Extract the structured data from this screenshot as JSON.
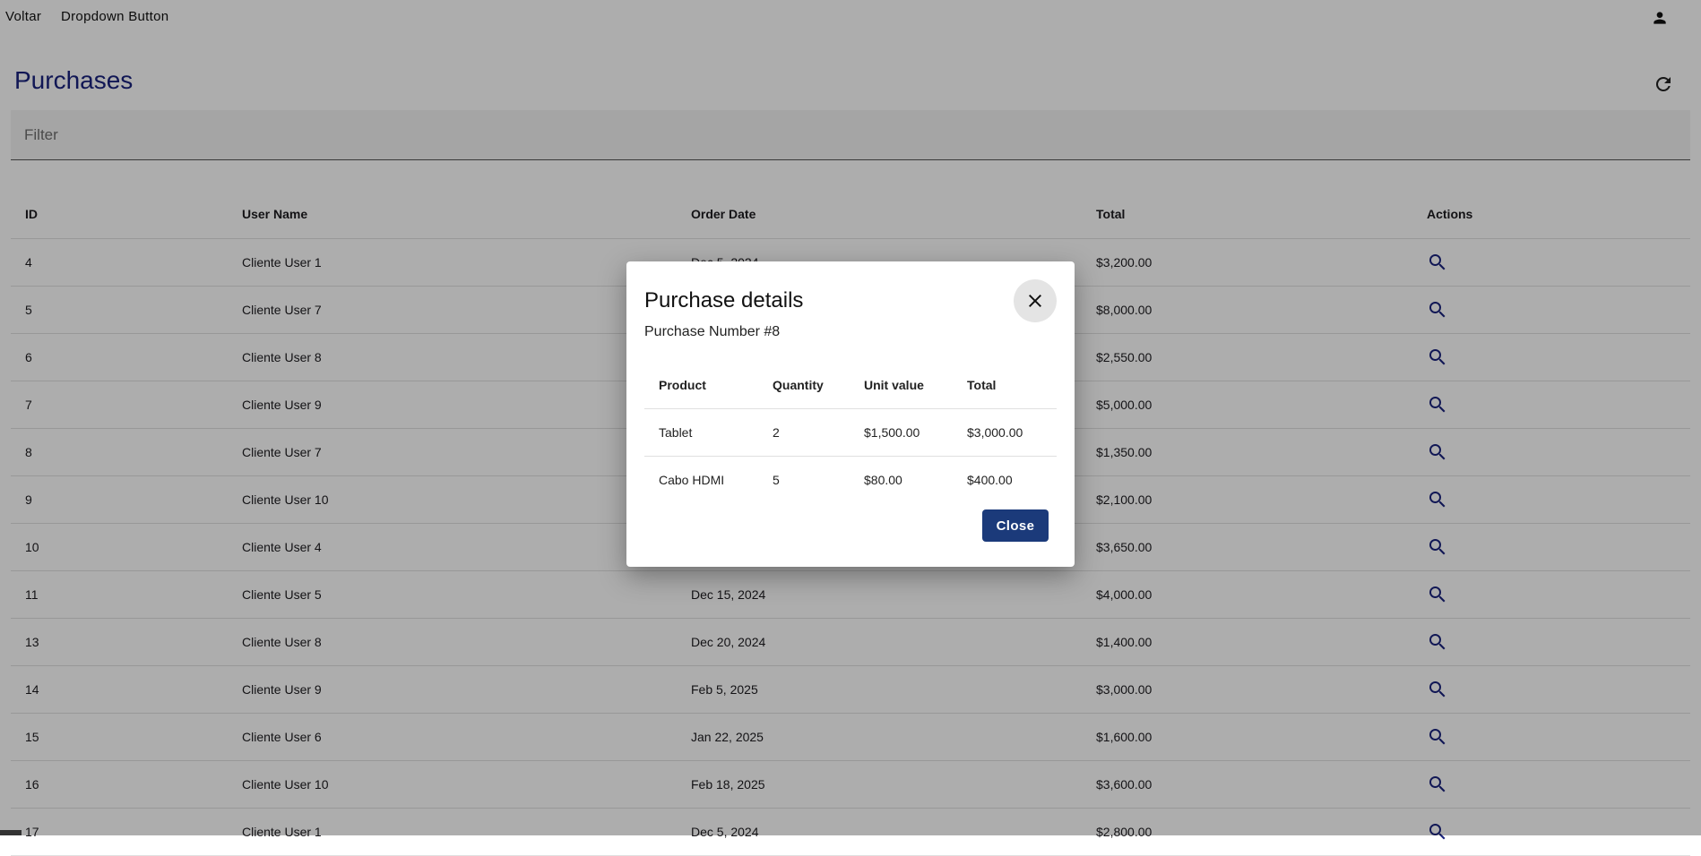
{
  "topbar": {
    "brand": "Voltar",
    "dropdown": "Dropdown Button",
    "user_icon": "account-icon"
  },
  "page": {
    "title": "Purchases",
    "refresh_icon": "refresh-icon"
  },
  "filter": {
    "placeholder": "Filter",
    "value": ""
  },
  "table": {
    "headers": {
      "id": "ID",
      "user": "User Name",
      "date": "Order Date",
      "total": "Total",
      "actions": "Actions"
    },
    "rows": [
      {
        "id": "4",
        "user": "Cliente User 1",
        "date": "Dec 5, 2024",
        "total": "$3,200.00"
      },
      {
        "id": "5",
        "user": "Cliente User 7",
        "date": "",
        "total": "$8,000.00"
      },
      {
        "id": "6",
        "user": "Cliente User 8",
        "date": "",
        "total": "$2,550.00"
      },
      {
        "id": "7",
        "user": "Cliente User 9",
        "date": "",
        "total": "$5,000.00"
      },
      {
        "id": "8",
        "user": "Cliente User 7",
        "date": "",
        "total": "$1,350.00"
      },
      {
        "id": "9",
        "user": "Cliente User 10",
        "date": "",
        "total": "$2,100.00"
      },
      {
        "id": "10",
        "user": "Cliente User 4",
        "date": "",
        "total": "$3,650.00"
      },
      {
        "id": "11",
        "user": "Cliente User 5",
        "date": "Dec 15, 2024",
        "total": "$4,000.00"
      },
      {
        "id": "13",
        "user": "Cliente User 8",
        "date": "Dec 20, 2024",
        "total": "$1,400.00"
      },
      {
        "id": "14",
        "user": "Cliente User 9",
        "date": "Feb 5, 2025",
        "total": "$3,000.00"
      },
      {
        "id": "15",
        "user": "Cliente User 6",
        "date": "Jan 22, 2025",
        "total": "$1,600.00"
      },
      {
        "id": "16",
        "user": "Cliente User 10",
        "date": "Feb 18, 2025",
        "total": "$3,600.00"
      },
      {
        "id": "17",
        "user": "Cliente User 1",
        "date": "Dec 5, 2024",
        "total": "$2,800.00"
      }
    ]
  },
  "dialog": {
    "title": "Purchase details",
    "subtitle": "Purchase Number #8",
    "headers": {
      "product": "Product",
      "qty": "Quantity",
      "unit": "Unit value",
      "total": "Total"
    },
    "rows": [
      {
        "product": "Tablet",
        "qty": "2",
        "unit": "$1,500.00",
        "total": "$3,000.00"
      },
      {
        "product": "Cabo HDMI",
        "qty": "5",
        "unit": "$80.00",
        "total": "$400.00"
      }
    ],
    "close_label": "Close"
  },
  "colors": {
    "primary": "#1a237e",
    "button": "#1b3a7a",
    "overlay": "rgba(0,0,0,0.32)"
  }
}
